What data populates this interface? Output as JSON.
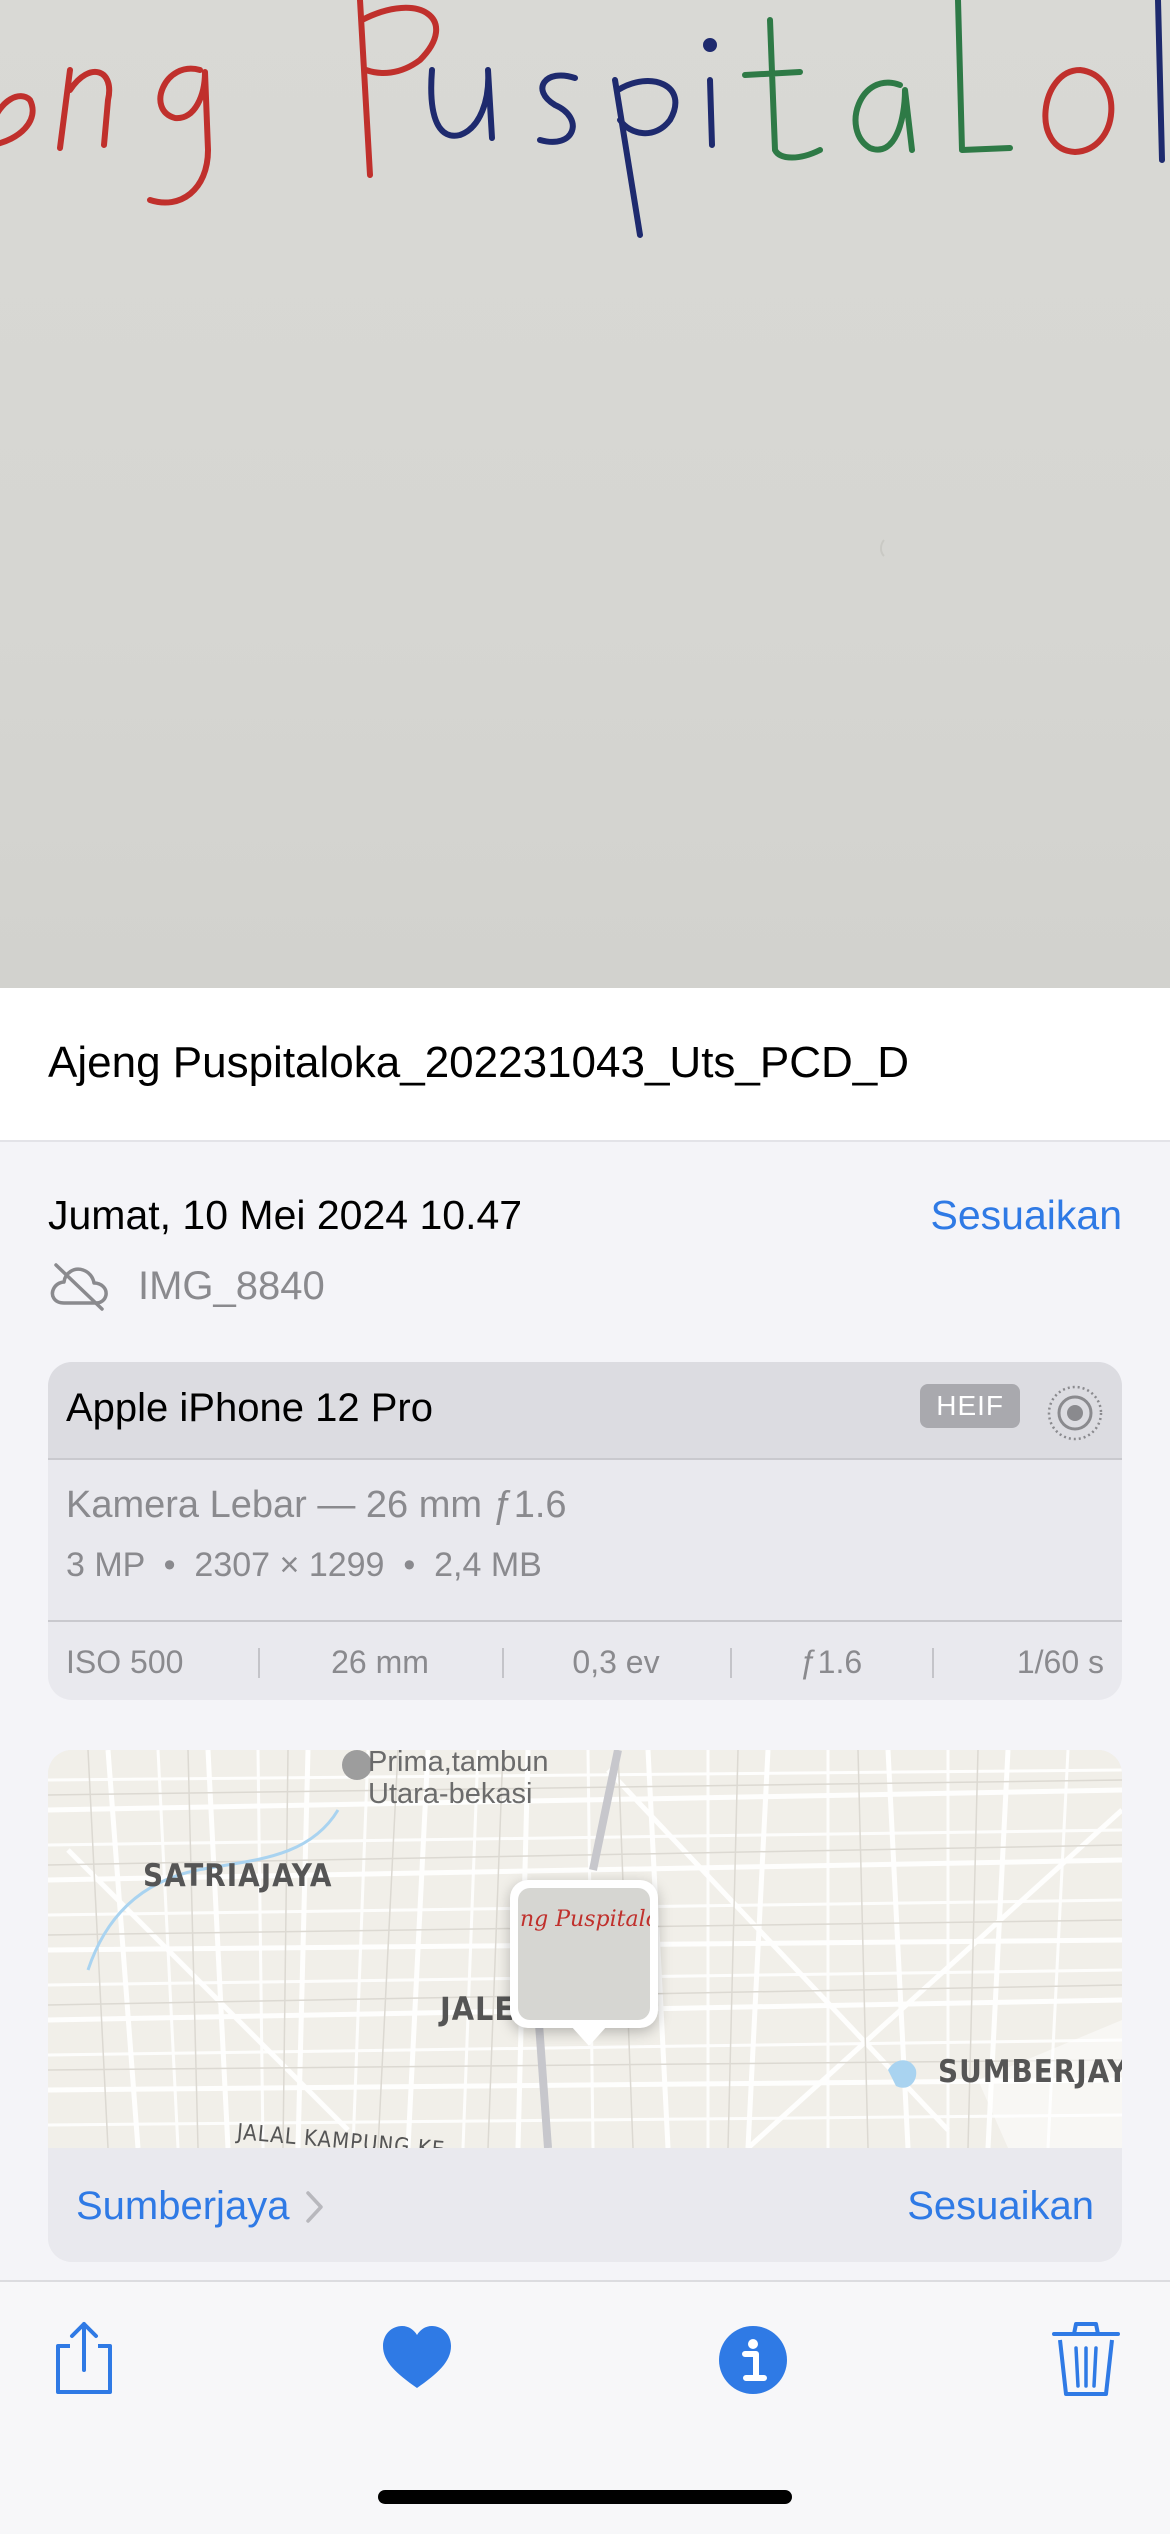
{
  "photo": {
    "handwriting_text": "jeng Puspitalok"
  },
  "caption": "Ajeng Puspitaloka_202231043_Uts_PCD_D",
  "date": "Jumat, 10 Mei 2024 10.47",
  "adjust_label": "Sesuaikan",
  "file": {
    "cloud_icon": "cloud-slash-icon",
    "name": "IMG_8840"
  },
  "camera": {
    "device": "Apple iPhone 12 Pro",
    "format_badge": "HEIF",
    "live_icon": "live-photo-icon",
    "lens": "Kamera Lebar — 26 mm ƒ1.6",
    "specs": "3 MP  •  2307 × 1299  •  2,4 MB",
    "exif": [
      "ISO 500",
      "26 mm",
      "0,3 ev",
      "ƒ1.6",
      "1/60 s"
    ]
  },
  "map": {
    "labels": {
      "poi": "Prima,tambun Utara-bekasi",
      "poi_line1": "Prima,tambun",
      "poi_line2": "Utara-bekasi",
      "district1": "SATRIAJAYA",
      "district2": "JALE",
      "district3": "SUMBERJAY",
      "road": "JALAL KAMPUNG KE"
    },
    "pin_thumbnail_text": "ng Puspitalo",
    "place": "Sumberjaya",
    "adjust_label": "Sesuaikan"
  },
  "toolbar": {
    "icons": [
      "share-icon",
      "heart-icon",
      "info-icon",
      "trash-icon"
    ],
    "accent": "#2f7ae5"
  },
  "colors": {
    "accent": "#2f7ae5",
    "secondary_text": "#8a8a8e"
  }
}
